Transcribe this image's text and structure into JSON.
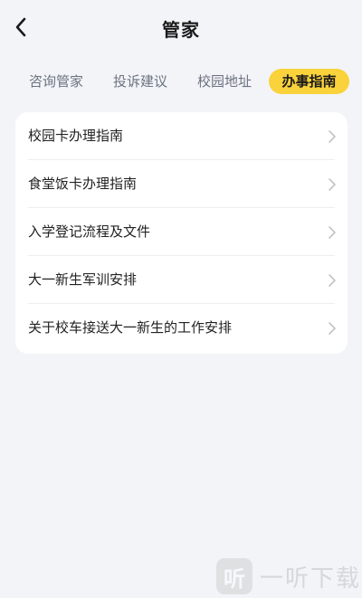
{
  "header": {
    "title": "管家",
    "back_icon": "chevron-left-icon"
  },
  "tabs": [
    {
      "label": "咨询管家",
      "active": false
    },
    {
      "label": "投诉建议",
      "active": false
    },
    {
      "label": "校园地址",
      "active": false
    },
    {
      "label": "办事指南",
      "active": true
    }
  ],
  "guide_list": {
    "items": [
      {
        "label": "校园卡办理指南"
      },
      {
        "label": "食堂饭卡办理指南"
      },
      {
        "label": "入学登记流程及文件"
      },
      {
        "label": "大一新生军训安排"
      },
      {
        "label": "关于校车接送大一新生的工作安排"
      }
    ],
    "chevron_icon": "chevron-right-icon"
  },
  "watermark": {
    "logo_char": "听",
    "text": "一听下载"
  },
  "colors": {
    "background": "#f3f4f8",
    "card": "#ffffff",
    "accent": "#f9d23c",
    "tab_inactive": "#6b7280",
    "chevron": "#c4c4c4"
  }
}
